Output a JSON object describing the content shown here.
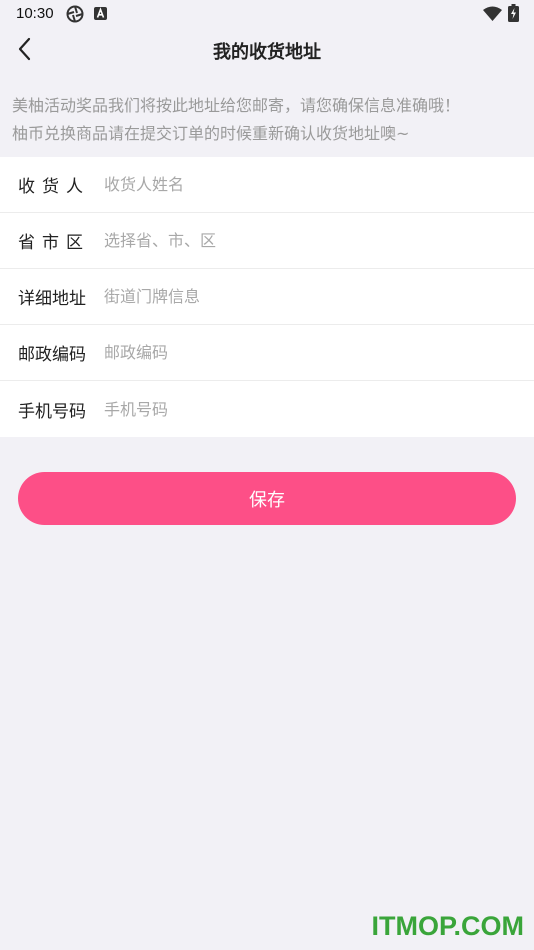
{
  "status_bar": {
    "time": "10:30",
    "icons": [
      "aperture-icon",
      "a-badge-icon",
      "wifi-icon",
      "battery-charging-icon"
    ]
  },
  "header": {
    "title": "我的收货地址",
    "back_icon": "chevron-left-icon"
  },
  "notice": {
    "line1": "美柚活动奖品我们将按此地址给您邮寄，请您确保信息准确哦！",
    "line2": "柚币兑换商品请在提交订单的时候重新确认收货地址噢~"
  },
  "form": {
    "rows": [
      {
        "label": "收货人",
        "placeholder": "收货人姓名",
        "value": ""
      },
      {
        "label": "省市区",
        "placeholder": "选择省、市、区",
        "value": ""
      },
      {
        "label": "详细地址",
        "placeholder": "街道门牌信息",
        "value": ""
      },
      {
        "label": "邮政编码",
        "placeholder": "邮政编码",
        "value": ""
      },
      {
        "label": "手机号码",
        "placeholder": "手机号码",
        "value": ""
      }
    ]
  },
  "save_button": {
    "label": "保存"
  },
  "watermark": {
    "text": "ITMOP.COM"
  },
  "colors": {
    "accent": "#fd4f87",
    "background": "#f2f1f6",
    "hint_text": "#9a9a9a",
    "watermark": "#3aa53a"
  }
}
